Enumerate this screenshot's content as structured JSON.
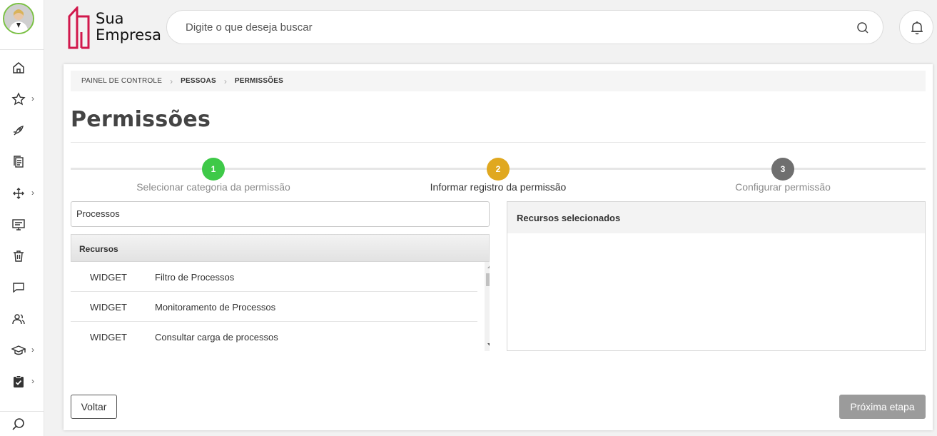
{
  "header": {
    "logo_line1": "Sua",
    "logo_line2": "Empresa",
    "search_placeholder": "Digite o que deseja buscar"
  },
  "sidebar": {
    "items": [
      {
        "icon": "home-icon",
        "has_chevron": false
      },
      {
        "icon": "star-icon",
        "has_chevron": true
      },
      {
        "icon": "rocket-icon",
        "has_chevron": false
      },
      {
        "icon": "documents-icon",
        "has_chevron": false
      },
      {
        "icon": "arrows-icon",
        "has_chevron": true
      },
      {
        "icon": "monitor-icon",
        "has_chevron": false
      },
      {
        "icon": "trash-icon",
        "has_chevron": false
      },
      {
        "icon": "chat-icon",
        "has_chevron": false
      },
      {
        "icon": "users-icon",
        "has_chevron": false
      },
      {
        "icon": "graduation-cap-icon",
        "has_chevron": true
      },
      {
        "icon": "clipboard-check-icon",
        "has_chevron": true
      }
    ],
    "bottom_icon": "search-icon"
  },
  "breadcrumb": {
    "items": [
      "PAINEL DE CONTROLE",
      "PESSOAS",
      "PERMISSÕES"
    ]
  },
  "page_title": "Permissões",
  "stepper": {
    "steps": [
      {
        "number": "1",
        "label": "Selecionar categoria da permissão",
        "color": "#3ec948",
        "label_color": "#8a8a8a"
      },
      {
        "number": "2",
        "label": "Informar registro da permissão",
        "color": "#e0a820",
        "label_color": "#333333"
      },
      {
        "number": "3",
        "label": "Configurar permissão",
        "color": "#6f6f6f",
        "label_color": "#8a8a8a"
      }
    ]
  },
  "filter_value": "Processos",
  "resources": {
    "header": "Recursos",
    "rows": [
      {
        "type": "WIDGET",
        "name": "Filtro de Processos"
      },
      {
        "type": "WIDGET",
        "name": "Monitoramento de Processos"
      },
      {
        "type": "WIDGET",
        "name": "Consultar carga de processos"
      }
    ]
  },
  "selected": {
    "header": "Recursos selecionados"
  },
  "buttons": {
    "back": "Voltar",
    "next": "Próxima etapa"
  },
  "colors": {
    "accent_logo": "#d1184c",
    "avatar_ring": "#7ac143"
  }
}
